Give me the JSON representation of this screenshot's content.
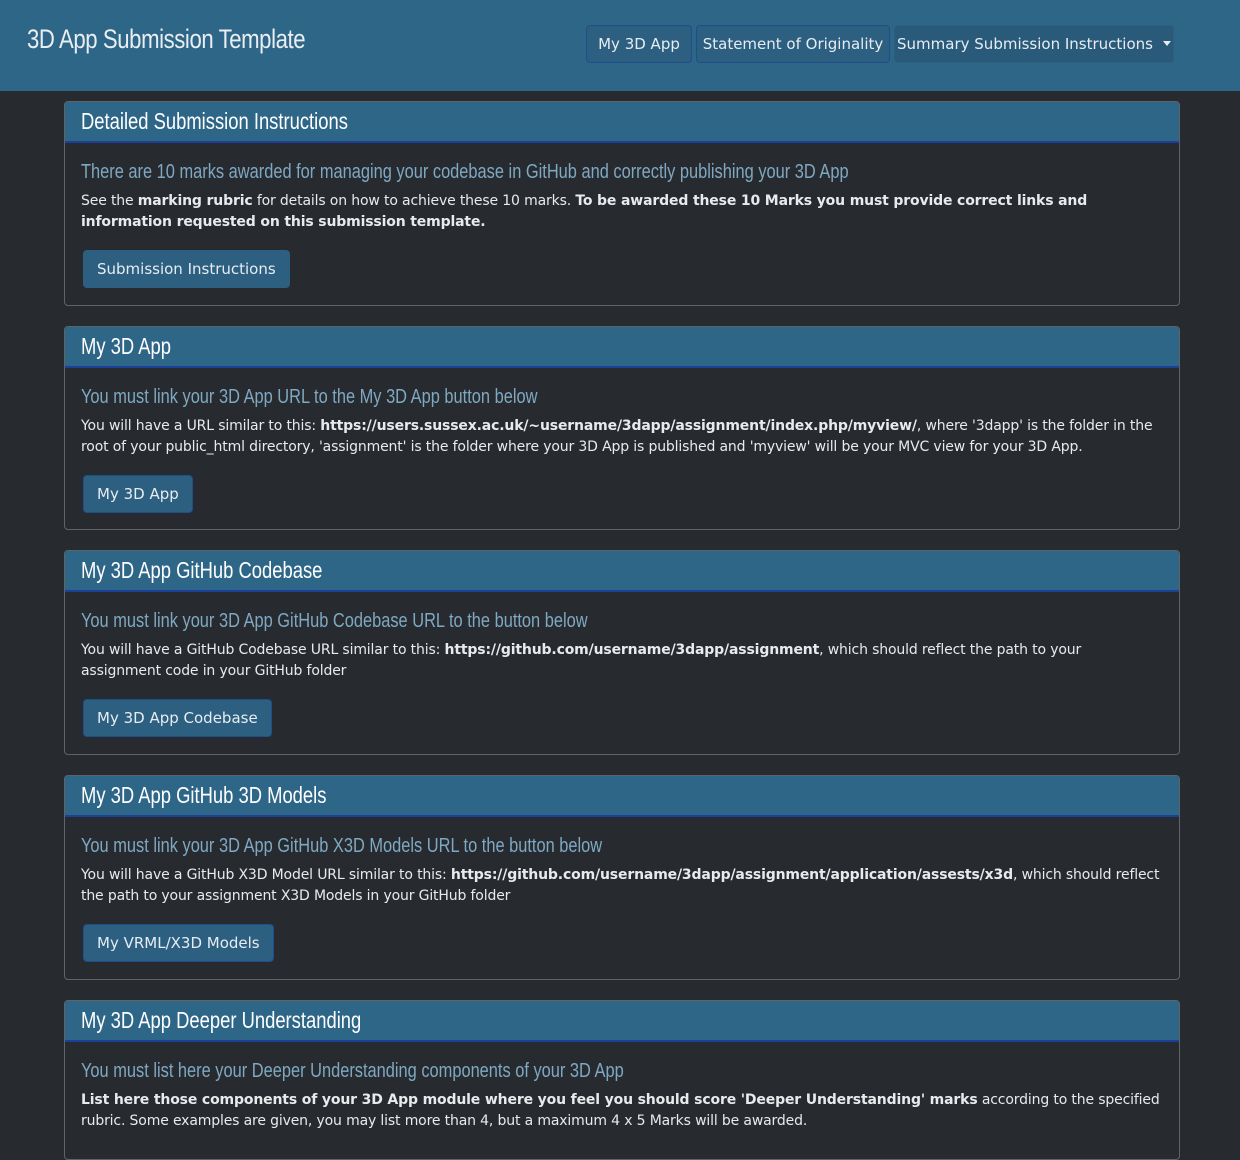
{
  "navbar": {
    "brand": "3D App Submission Template",
    "links": [
      "My 3D App",
      "Statement of Originality"
    ],
    "dropdown_label": "Summary Submission Instructions"
  },
  "cards": [
    {
      "title": "Detailed Submission Instructions",
      "subtitle": "There are 10 marks awarded for managing your codebase in GitHub and correctly publishing your 3D App",
      "text_1": "See the ",
      "bold_1": "marking rubric",
      "text_2": " for details on how to achieve these 10 marks. ",
      "bold_2": "To be awarded these 10 Marks you must provide correct links and information requested on this submission template.",
      "button": "Submission Instructions"
    },
    {
      "title": "My 3D App",
      "subtitle": "You must link your 3D App URL to the My 3D App button below",
      "text_1": "You will have a URL similar to this: ",
      "bold_1": "https://users.sussex.ac.uk/~username/3dapp/assignment/index.php/myview/",
      "text_2": ", where '3dapp' is the folder in the root of your public_html directory, 'assignment' is the folder where your 3D App is published and 'myview' will be your MVC view for your 3D App.",
      "button": "My 3D App"
    },
    {
      "title": "My 3D App GitHub Codebase",
      "subtitle": "You must link your 3D App GitHub Codebase URL to the button below",
      "text_1": "You will have a GitHub Codebase URL similar to this: ",
      "bold_1": "https://github.com/username/3dapp/assignment",
      "text_2": ", which should reflect the path to your assignment code in your GitHub folder",
      "button": "My 3D App Codebase"
    },
    {
      "title": "My 3D App GitHub 3D Models",
      "subtitle": "You must link your 3D App GitHub X3D Models URL to the button below",
      "text_1": "You will have a GitHub X3D Model URL similar to this: ",
      "bold_1": "https://github.com/username/3dapp/assignment/application/assests/x3d",
      "text_2": ", which should reflect the path to your assignment X3D Models in your GitHub folder",
      "button": "My VRML/X3D Models"
    },
    {
      "title": "My 3D App Deeper Understanding",
      "subtitle": "You must list here your Deeper Understanding components of your 3D App",
      "bold_1": "List here those components of your 3D App module where you feel you should score 'Deeper Understanding' marks",
      "text_2": " according to the specified rubric. Some examples are given, you may list more than 4, but a maximum 4 x 5 Marks will be awarded."
    }
  ]
}
